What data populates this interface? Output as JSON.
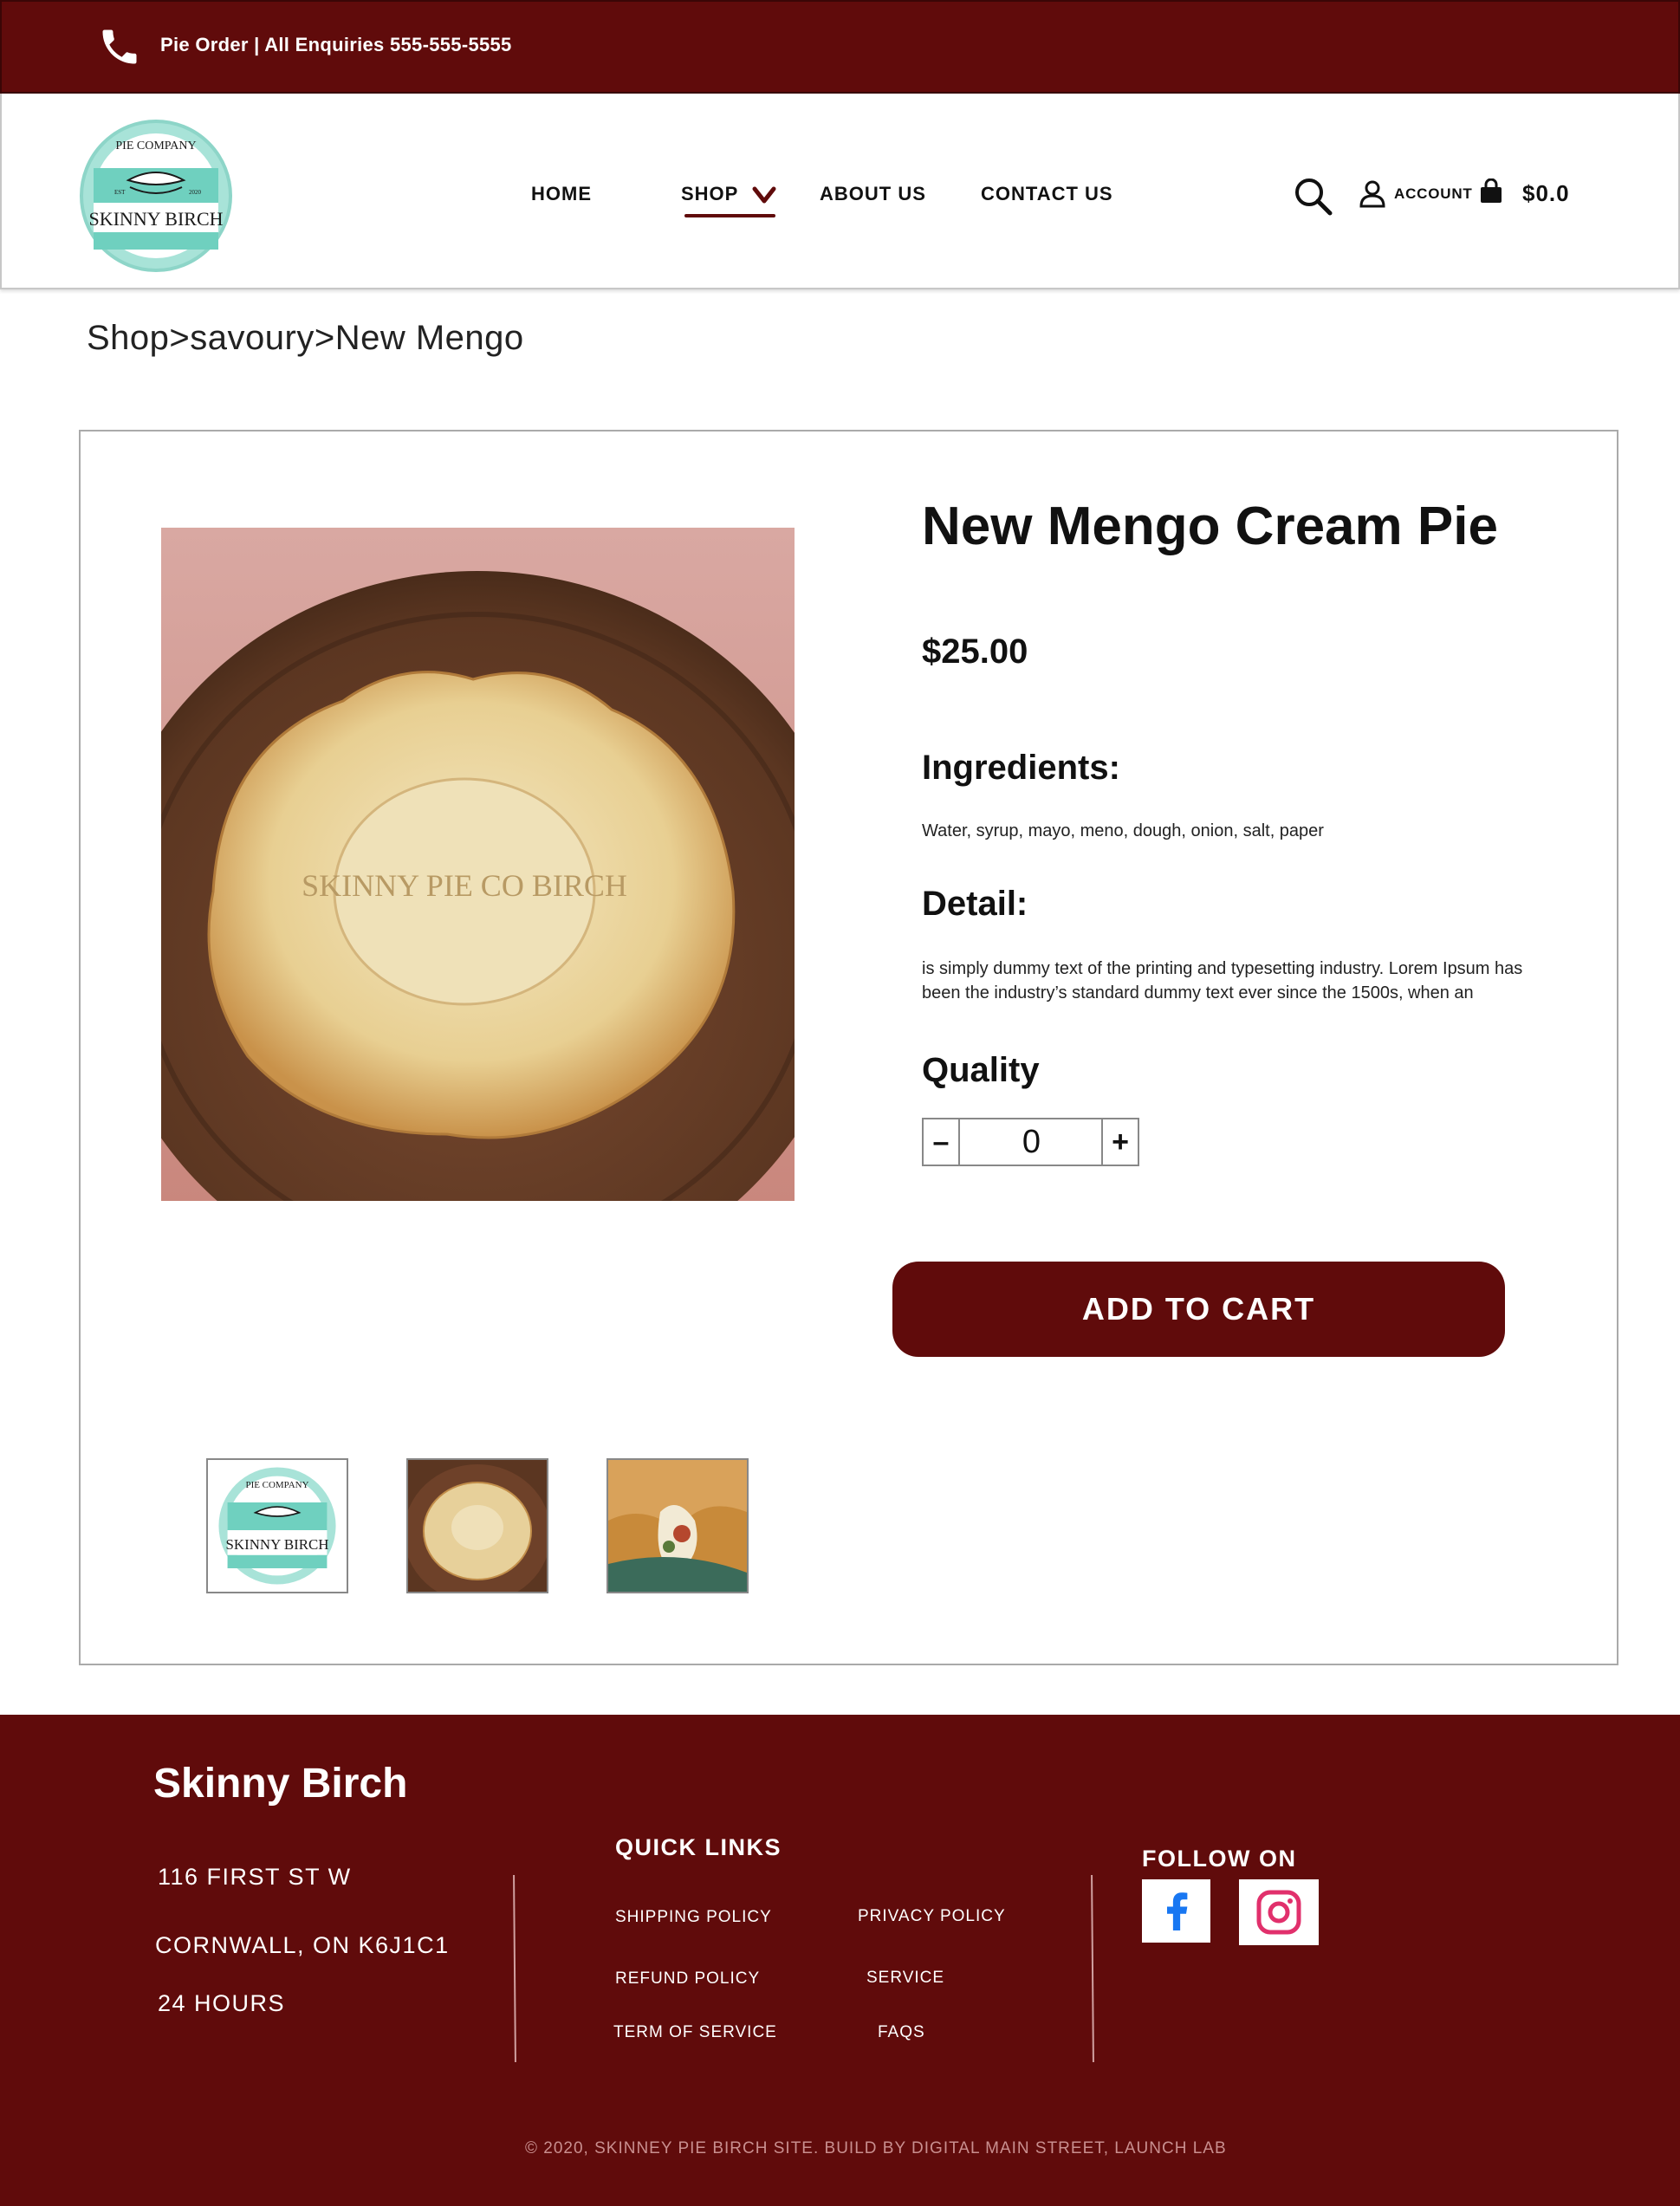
{
  "topbar": {
    "contact_text": "Pie Order | All Enquiries  555-555-5555",
    "phone_icon": "phone-icon"
  },
  "brand": {
    "logo_top_text": "PIE COMPANY",
    "logo_name": "SKINNY BIRCH",
    "logo_est": "EST",
    "logo_year": "2020"
  },
  "nav": {
    "home": "HOME",
    "shop": "SHOP",
    "about": "ABOUT US",
    "contact": "CONTACT US",
    "account": "ACCOUNT",
    "cart_total": "$0.0"
  },
  "breadcrumb": "Shop>savoury>New Mengo",
  "product": {
    "title": "New Mengo Cream Pie",
    "price": "$25.00",
    "ingredients_heading": "Ingredients:",
    "ingredients": "Water, syrup, mayo, meno, dough, onion, salt, paper",
    "detail_heading": "Detail:",
    "detail": "is simply dummy text of the printing and typesetting industry. Lorem Ipsum has been the industry’s standard dummy text ever since the 1500s, when an",
    "quality_heading": "Quality",
    "quantity": "0",
    "minus_label": "–",
    "plus_label": "+",
    "add_to_cart": "ADD TO CART",
    "pie_stamp_text": "SKINNY PIE CO BIRCH"
  },
  "footer": {
    "brand": "Skinny Birch",
    "address_line1": "116 FIRST ST W",
    "address_line2": "CORNWALL, ON K6J1C1",
    "hours": "24 HOURS",
    "quick_links_heading": "QUICK LINKS",
    "links": {
      "shipping": "SHIPPING POLICY",
      "privacy": "PRIVACY POLICY",
      "refund": "REFUND POLICY",
      "service": "SERVICE",
      "terms": "TERM OF SERVICE",
      "faqs": "FAQS"
    },
    "follow_heading": "FOLLOW ON",
    "copyright": "© 2020, SKINNEY PIE BIRCH SITE. BUILD BY DIGITAL MAIN STREET, LAUNCH LAB"
  },
  "colors": {
    "brand_maroon": "#600b0b",
    "logo_teal": "#7fd6c6",
    "facebook_blue": "#1877f2",
    "instagram_pink": "#e1306c"
  }
}
